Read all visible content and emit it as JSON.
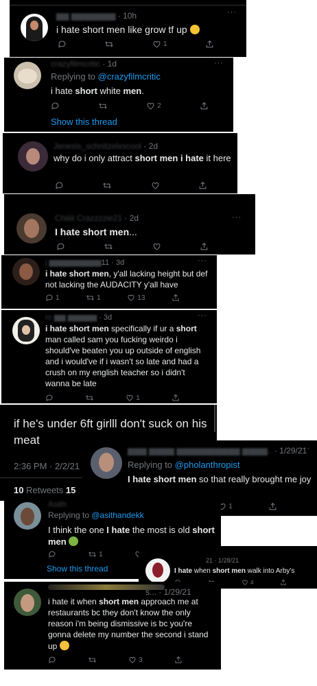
{
  "colors": {
    "bg": "#000000",
    "text": "#e7e9ea",
    "muted": "#71767b",
    "link": "#1d9bf0"
  },
  "tweets": [
    {
      "meta": "· 10h",
      "pre": "i hate short men like grow tf up",
      "emoji": "face-with-hand-over-mouth",
      "counts": {
        "reply": "",
        "retweet": "",
        "like": "1"
      }
    },
    {
      "name_blur": "crazyfilmcritic",
      "meta": "· 1d",
      "reply_prefix": "Replying to ",
      "reply_mention": "@crazyfilmcritic",
      "pre": "i hate ",
      "bold1": "short",
      "mid": " white ",
      "bold2": "men",
      "post": ".",
      "counts": {
        "reply": "",
        "retweet": "",
        "like": "2"
      },
      "show_thread": "Show this thread"
    },
    {
      "name_blur": "Jenesis_schnitzelxscool",
      "meta": "· 2d",
      "pre": "why do i only attract ",
      "bold1": "short men i hate",
      "post": " it here",
      "counts": {
        "reply": "",
        "retweet": "",
        "like": ""
      }
    },
    {
      "name_blur": "Chiiiii Crazzzzie21",
      "meta": "· 2d",
      "bold1": "I hate short men",
      "post": "...",
      "counts": {
        "reply": "",
        "retweet": "",
        "like": ""
      }
    },
    {
      "name_blur": "j",
      "meta": "11 · 3d",
      "bold1": "i hate short men",
      "post": ", y'all lacking height but def not lacking the AUDACITY y'all have",
      "counts": {
        "reply": "1",
        "retweet": "1",
        "like": "13"
      }
    },
    {
      "name_blur": "ro",
      "meta": "· 3d",
      "bold1": "i hate short men",
      "mid": " specifically if ur a ",
      "bold2": "short",
      "post": " man called sam you fucking weirdo i should've beaten you up outside of english and i would've if i wasn't so late and had a crush on my english teacher so i didn't wanna be late",
      "counts": {
        "reply": "",
        "retweet": "",
        "like": "1"
      }
    },
    {
      "text": "if he's under 6ft girlll don't suck on his meat",
      "time": "2:36 PM · 2/2/21 ·",
      "retweets": "10",
      "retweets_label": "Retweets",
      "quotes": "15"
    },
    {
      "name_blur": "Unknown",
      "meta": "· 1/29/21",
      "reply_prefix": "Replying to ",
      "reply_mention": "@pholanthropist",
      "bold1": "I hate short men",
      "post": " so that really brought me joy",
      "counts": {
        "reply": "",
        "retweet": "",
        "like": "1"
      }
    },
    {
      "name_blur": "Asith",
      "reply_prefix": "Replying to ",
      "reply_mention": "@asithandekk",
      "pre": "I think the one ",
      "bold1": "I hate",
      "mid": " the most is old ",
      "bold2": "short men",
      "emoji": "nauseated-face",
      "counts": {
        "reply": "",
        "retweet": "1",
        "like": ""
      },
      "show_thread": "Show this thread"
    },
    {
      "meta": "21 · 1/28/21",
      "bold1": "I hate",
      "mid": " when ",
      "bold2": "short men",
      "post": " walk into Arby's",
      "counts": {
        "reply": "",
        "retweet": "",
        "like": "4"
      }
    },
    {
      "meta": "s... · 1/29/21",
      "pre": "i hate it when ",
      "bold1": "short men",
      "post": " approach me at restaurants bc they don't know the only reason i'm being dismissive is bc you're gonna delete my number the second i stand up",
      "emoji": "crying-face",
      "counts": {
        "reply": "",
        "retweet": "",
        "like": "3"
      }
    }
  ]
}
